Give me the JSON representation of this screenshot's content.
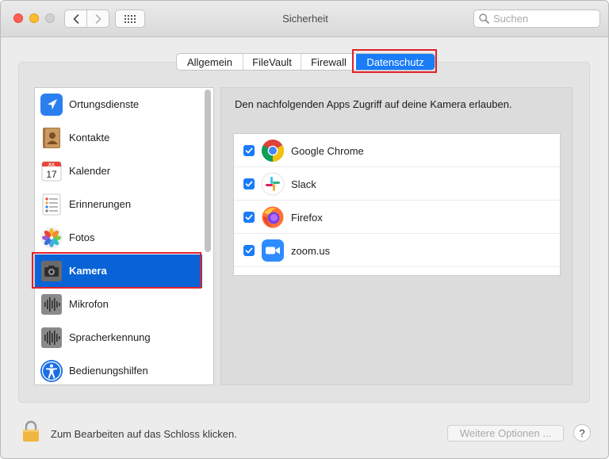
{
  "window": {
    "title": "Sicherheit",
    "search_placeholder": "Suchen"
  },
  "tabs": [
    {
      "label": "Allgemein",
      "selected": false
    },
    {
      "label": "FileVault",
      "selected": false
    },
    {
      "label": "Firewall",
      "selected": false
    },
    {
      "label": "Datenschutz",
      "selected": true
    }
  ],
  "sidebar": {
    "items": [
      {
        "label": "Ortungsdienste",
        "icon": "location-arrow-icon"
      },
      {
        "label": "Kontakte",
        "icon": "contacts-book-icon"
      },
      {
        "label": "Kalender",
        "icon": "calendar-icon",
        "icon_month": "JUL",
        "icon_day": "17"
      },
      {
        "label": "Erinnerungen",
        "icon": "reminders-list-icon"
      },
      {
        "label": "Fotos",
        "icon": "photos-flower-icon"
      },
      {
        "label": "Kamera",
        "icon": "camera-icon",
        "selected": true
      },
      {
        "label": "Mikrofon",
        "icon": "microphone-waveform-icon"
      },
      {
        "label": "Spracherkennung",
        "icon": "speech-waveform-icon"
      },
      {
        "label": "Bedienungshilfen",
        "icon": "accessibility-icon"
      }
    ]
  },
  "main": {
    "description": "Den nachfolgenden Apps Zugriff auf deine Kamera erlauben.",
    "apps": [
      {
        "name": "Google Chrome",
        "checked": true,
        "icon": "chrome-icon"
      },
      {
        "name": "Slack",
        "checked": true,
        "icon": "slack-icon"
      },
      {
        "name": "Firefox",
        "checked": true,
        "icon": "firefox-icon"
      },
      {
        "name": "zoom.us",
        "checked": true,
        "icon": "zoom-icon"
      }
    ]
  },
  "footer": {
    "lock_text": "Zum Bearbeiten auf das Schloss klicken.",
    "more_options_label": "Weitere Optionen ...",
    "help_label": "?"
  },
  "colors": {
    "accent": "#1a7cf7",
    "selection": "#0a63d6",
    "highlight_box": "#e0202a"
  }
}
